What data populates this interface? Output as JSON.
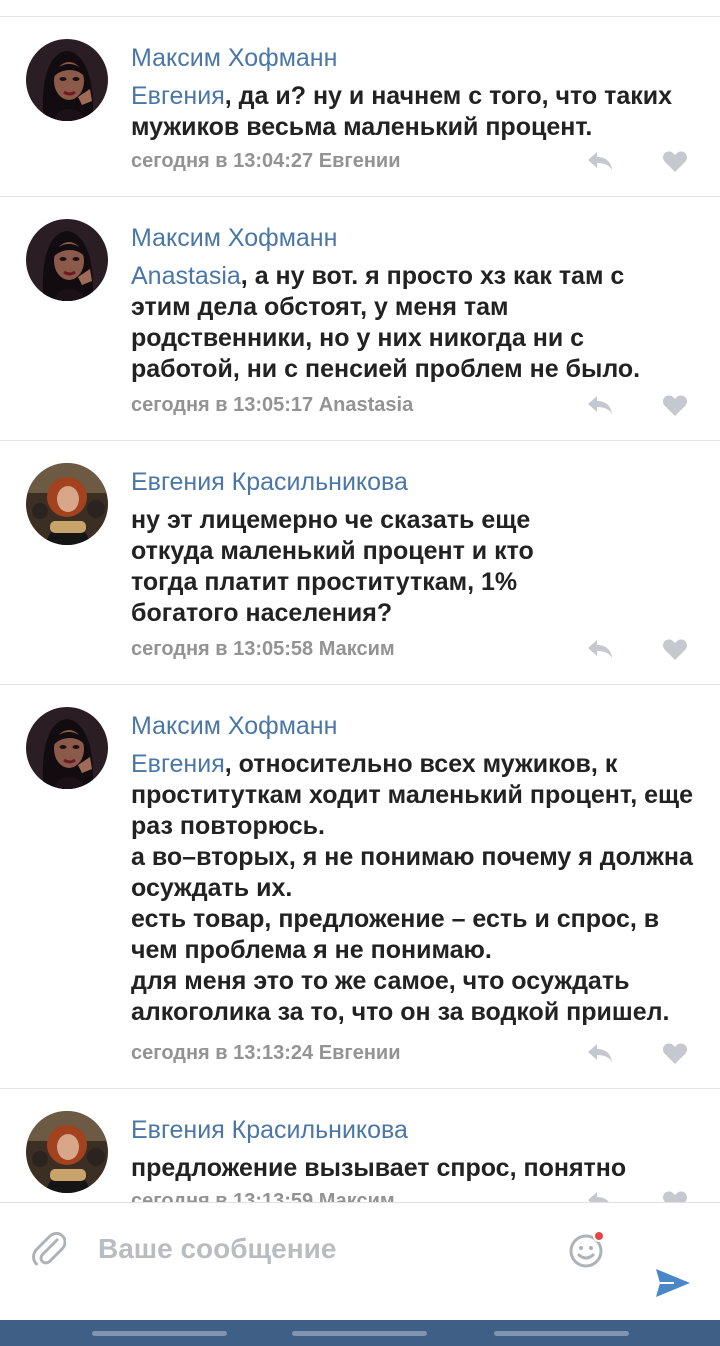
{
  "comments": [
    {
      "author": "Максим Хофманн",
      "reply_to": "Евгения",
      "text": ", да и? ну и начнем с того, что таких мужиков весьма маленький процент.",
      "meta": "сегодня в 13:04:27 Евгении",
      "avatar": "dark-haired-woman-illustration"
    },
    {
      "author": "Максим Хофманн",
      "reply_to": "Anastasia",
      "text": ", а ну вот. я просто хз как там с этим дела обстоят, у меня там родственники, но у них никогда ни с работой, ни с пенсией проблем не было.",
      "meta": "сегодня в 13:05:17 Anastasia",
      "avatar": "dark-haired-woman-illustration"
    },
    {
      "author": "Евгения Красильникова",
      "reply_to": "",
      "text": "ну эт лицемерно че сказать еще откуда маленький процент и кто тогда платит проституткам, 1% богатого населения?",
      "meta": "сегодня в 13:05:58 Максим",
      "avatar": "red-haired-woman-photo"
    },
    {
      "author": "Максим Хофманн",
      "reply_to": "Евгения",
      "text": ", относительно всех мужиков, к проституткам ходит маленький процент, еще раз повторюсь.\nа во–вторых, я не понимаю почему я должна осуждать их.\nесть товар, предложение – есть и спрос, в чем проблема я не понимаю.\nдля меня это то же самое, что осуждать алкоголика за то, что он за водкой пришел.",
      "meta": "сегодня в 13:13:24 Евгении",
      "avatar": "dark-haired-woman-illustration"
    },
    {
      "author": "Евгения Красильникова",
      "reply_to": "",
      "text": "предложение вызывает спрос, понятно",
      "meta": "сегодня в 13:13:59 Максим",
      "avatar": "red-haired-woman-photo"
    }
  ],
  "composer": {
    "placeholder": "Ваше сообщение",
    "icons": [
      "paperclip-icon",
      "emoji-icon",
      "send-icon"
    ],
    "notification_dot_color": "#e64646"
  },
  "colors": {
    "link": "#4a76a8",
    "text": "#222222",
    "meta": "#939393",
    "bottom_bar": "#3f5f86"
  }
}
